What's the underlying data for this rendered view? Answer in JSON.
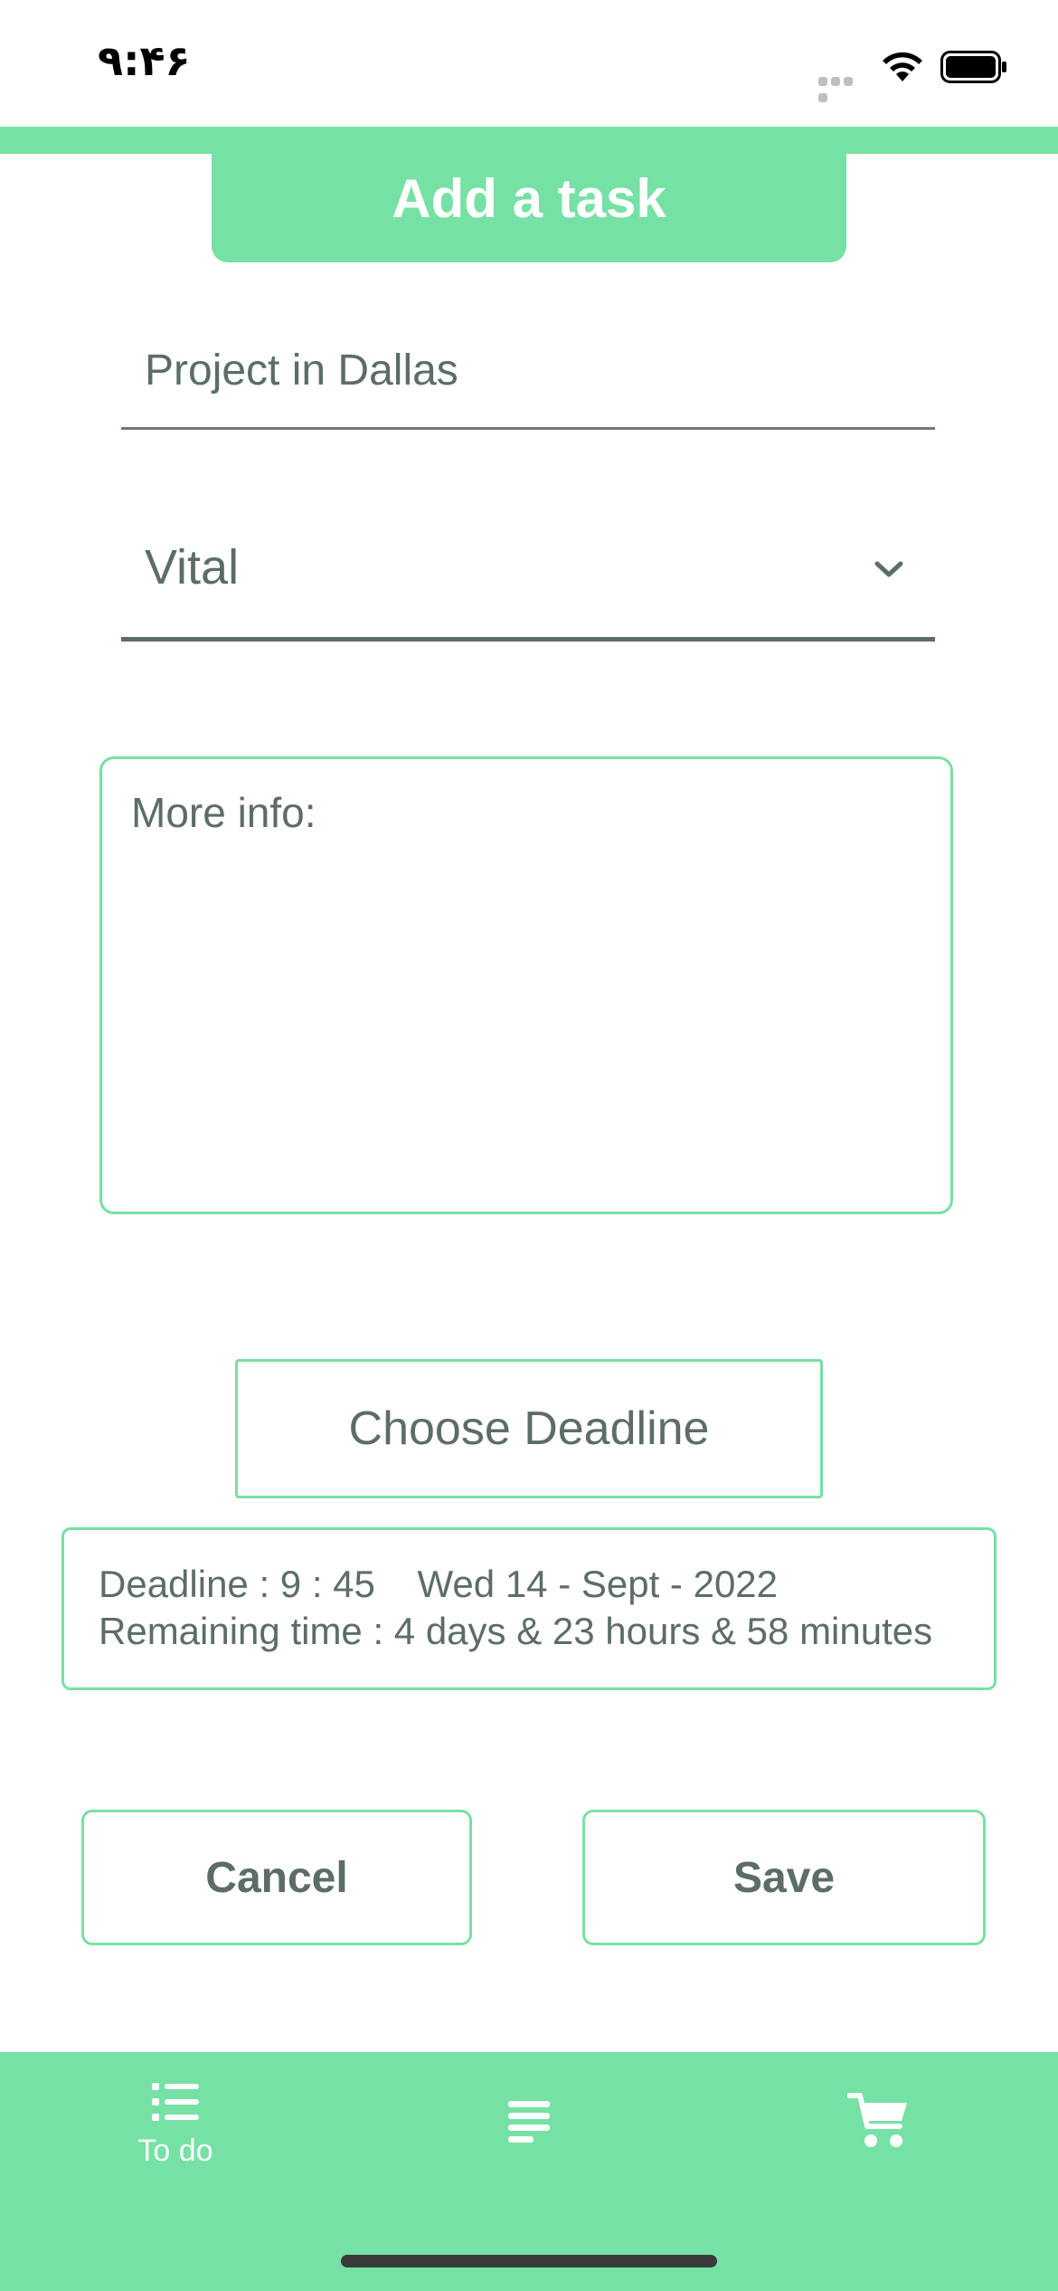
{
  "status_bar": {
    "time": "۹:۴۶"
  },
  "header": {
    "title": "Add a task"
  },
  "form": {
    "task_name": "Project in Dallas",
    "priority": "Vital",
    "more_info_placeholder": "More info:"
  },
  "deadline": {
    "choose_label": "Choose Deadline",
    "deadline_line": "Deadline : 9 : 45    Wed 14 - Sept - 2022",
    "remaining_line": "Remaining time : 4 days & 23 hours & 58 minutes"
  },
  "actions": {
    "cancel_label": "Cancel",
    "save_label": "Save"
  },
  "tab_bar": {
    "items": [
      {
        "label": "To do",
        "icon": "list-bullets-icon"
      },
      {
        "label": "",
        "icon": "lines-icon"
      },
      {
        "label": "",
        "icon": "cart-icon"
      }
    ]
  },
  "colors": {
    "accent": "#76e1a4",
    "text": "#5c6d68",
    "background": "#ffffff"
  }
}
